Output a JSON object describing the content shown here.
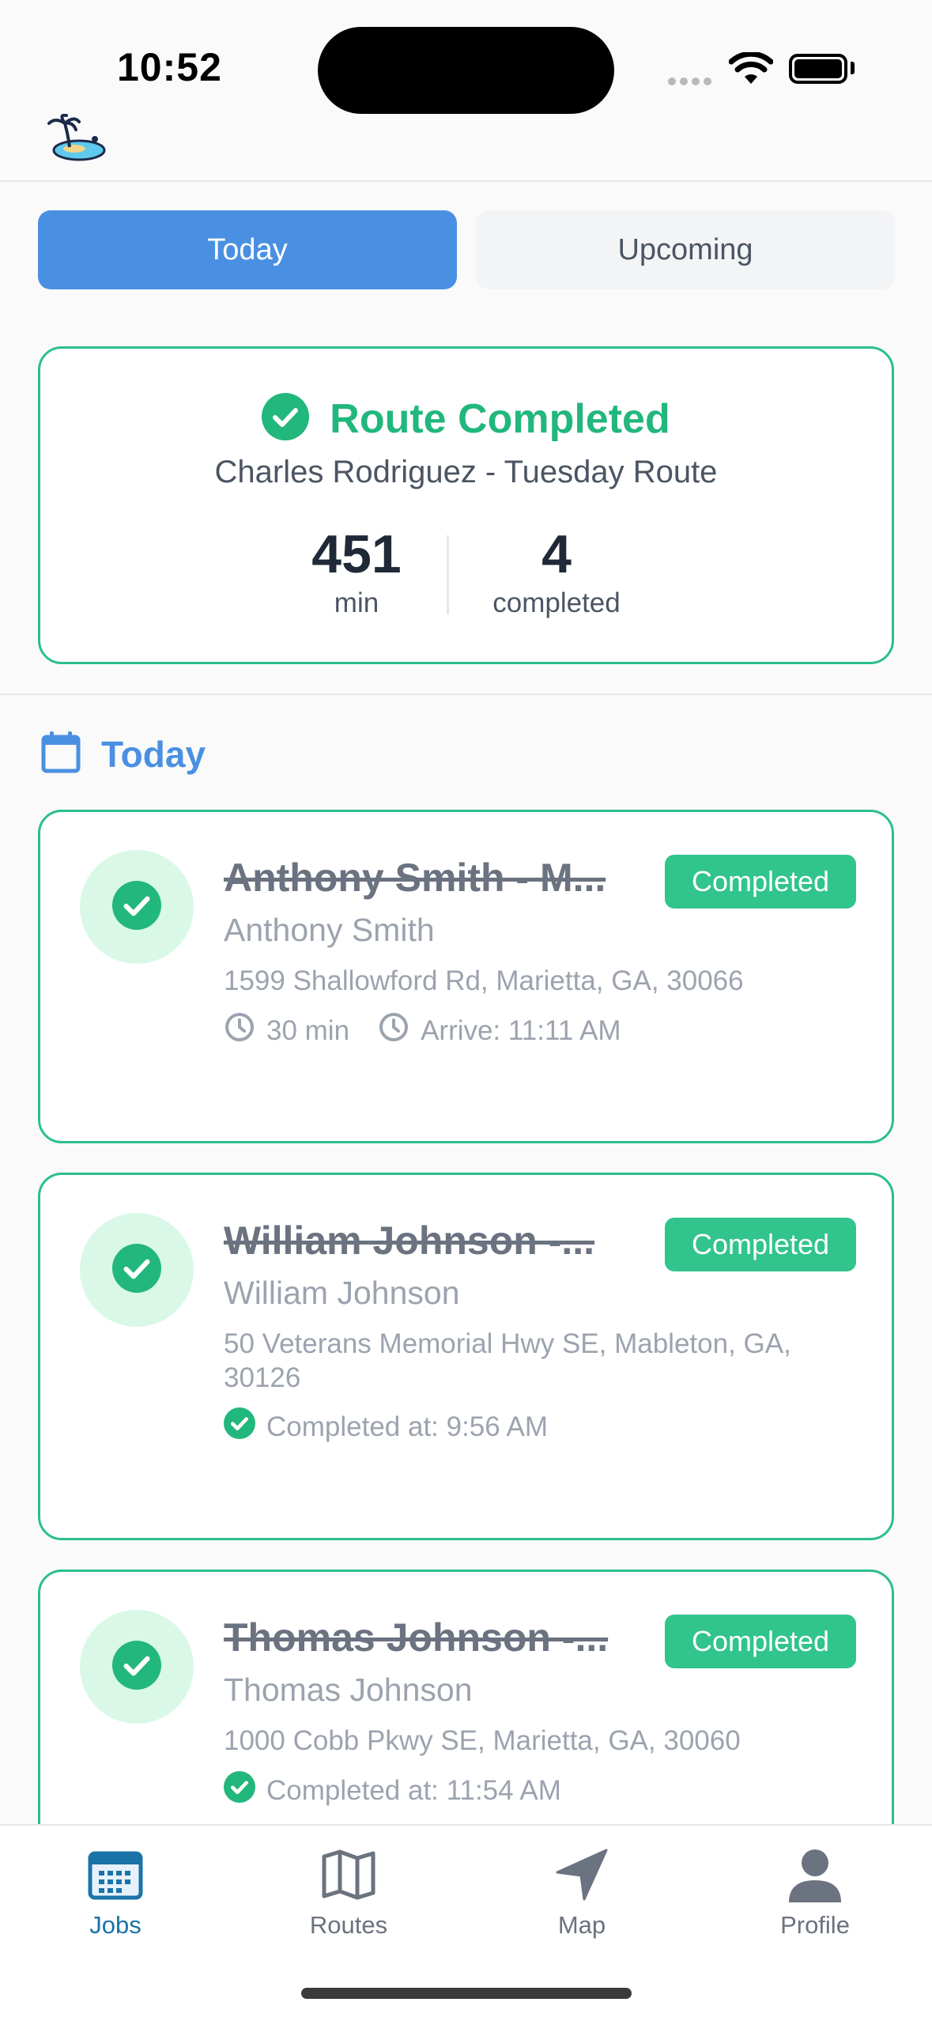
{
  "status_bar": {
    "time": "10:52"
  },
  "tabs": [
    {
      "label": "Today",
      "active": true
    },
    {
      "label": "Upcoming",
      "active": false
    }
  ],
  "summary": {
    "title": "Route Completed",
    "subtitle": "Charles Rodriguez - Tuesday Route",
    "stats": [
      {
        "value": "451",
        "label": "min"
      },
      {
        "value": "4",
        "label": "completed"
      }
    ]
  },
  "section": {
    "title": "Today"
  },
  "jobs": [
    {
      "title": "Anthony Smith - M...",
      "badge": "Completed",
      "customer": "Anthony Smith",
      "address": "1599 Shallowford Rd, Marietta, GA, 30066",
      "duration": "30 min",
      "arrive": "Arrive: 11:11 AM"
    },
    {
      "title": "William Johnson -...",
      "badge": "Completed",
      "customer": "William Johnson",
      "address": "50 Veterans Memorial Hwy SE, Mableton, GA, 30126",
      "completed_at": "Completed at: 9:56 AM"
    },
    {
      "title": "Thomas Johnson -...",
      "badge": "Completed",
      "customer": "Thomas Johnson",
      "address": "1000 Cobb Pkwy SE, Marietta, GA, 30060",
      "completed_at": "Completed at: 11:54 AM"
    }
  ],
  "nav": [
    {
      "label": "Jobs",
      "icon": "calendar-icon",
      "active": true
    },
    {
      "label": "Routes",
      "icon": "map-icon",
      "active": false
    },
    {
      "label": "Map",
      "icon": "navigation-arrow-icon",
      "active": false
    },
    {
      "label": "Profile",
      "icon": "person-icon",
      "active": false
    }
  ],
  "colors": {
    "primary": "#4a90e2",
    "success": "#22b77c",
    "badge": "#31c48d",
    "nav_active": "#1a73a8"
  }
}
